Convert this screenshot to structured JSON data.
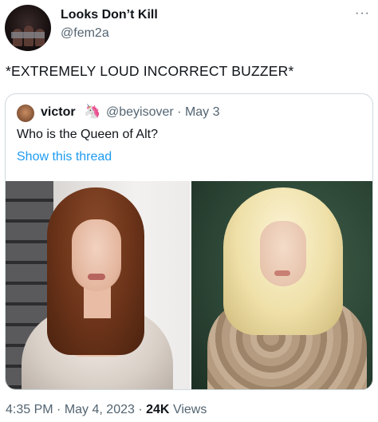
{
  "tweet": {
    "author_name": "Looks Don’t Kill",
    "author_handle": "@fem2a",
    "more_icon": "more-dots-icon",
    "text": "*EXTREMELY LOUD INCORRECT BUZZER*",
    "time": "4:35 PM",
    "date": "May 4, 2023",
    "views_count": "24K",
    "views_label": "Views",
    "separator": "·"
  },
  "quote": {
    "author_name": "victor",
    "author_emoji": "🦄",
    "author_handle": "@beyisover",
    "date": "May 3",
    "separator": "·",
    "text": "Who is the Queen of Alt?",
    "thread_link": "Show this thread"
  },
  "colors": {
    "text": "#0f1419",
    "secondary": "#536471",
    "link": "#1d9bf0",
    "border": "#cfd9de"
  }
}
